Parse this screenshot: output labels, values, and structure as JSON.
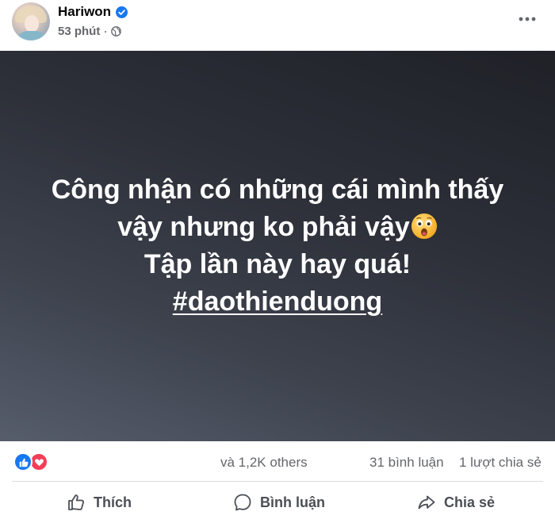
{
  "post": {
    "author_name": "Hariwon",
    "time": "53 phút",
    "separator": "·",
    "verified_icon": "verified-badge-icon",
    "privacy_icon": "globe-icon",
    "menu_icon": "more-options-icon",
    "text_lines": [
      "Công nhận có những cái mình thấy",
      "vậy nhưng ko phải vậy",
      "Tập lần này hay quá!"
    ],
    "hashtag": "#daothienduong",
    "emoji": "astonished-face-emoji"
  },
  "stats": {
    "reaction_icons": [
      "like-reaction-icon",
      "love-reaction-icon"
    ],
    "others": "và 1,2K others",
    "comments": "31 bình luận",
    "shares": "1 lượt chia sẻ"
  },
  "actions": {
    "like_label": "Thích",
    "comment_label": "Bình luận",
    "share_label": "Chia sẻ"
  },
  "colors": {
    "brand_blue": "#1877f2",
    "love_red": "#f33e58",
    "secondary_text": "#65676b",
    "background_dark": "#2d3039"
  }
}
